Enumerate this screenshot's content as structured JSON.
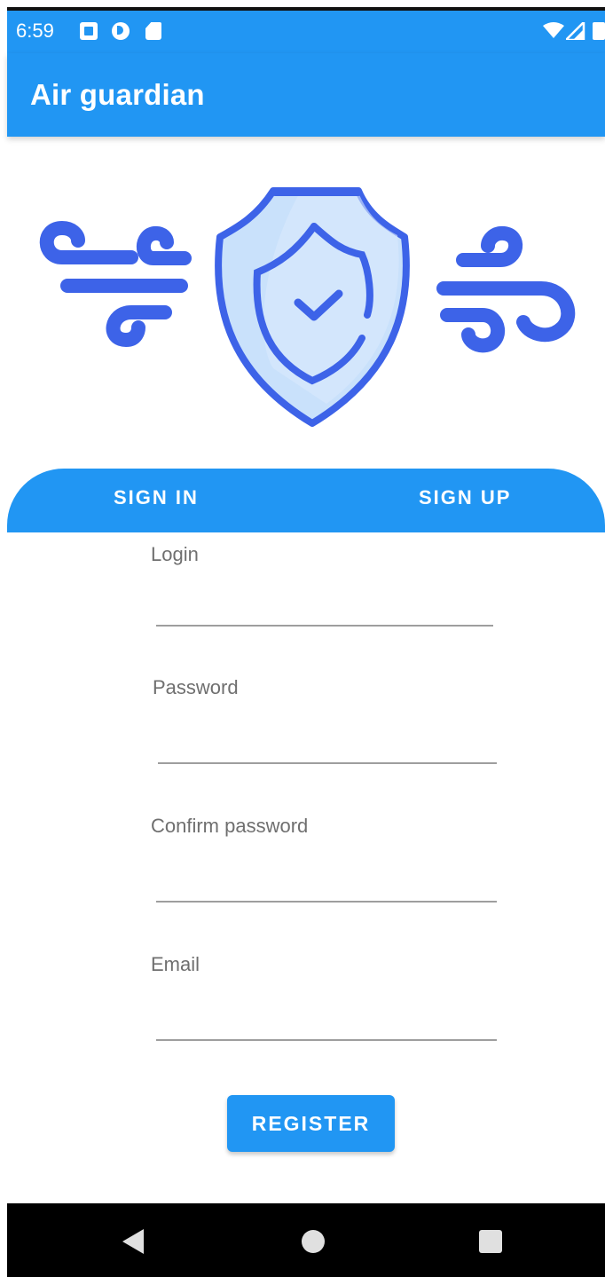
{
  "status_bar": {
    "time": "6:59",
    "icons": [
      "notification-a-icon",
      "notification-p-icon",
      "sd-card-icon",
      "wifi-icon",
      "signal-icon",
      "battery-icon"
    ]
  },
  "app_bar": {
    "title": "Air guardian"
  },
  "hero": {
    "icons": [
      "wind-left-icon",
      "shield-check-icon",
      "wind-right-icon"
    ]
  },
  "tabs": [
    {
      "label": "SIGN IN"
    },
    {
      "label": "SIGN UP"
    }
  ],
  "form": {
    "login": {
      "label": "Login",
      "value": ""
    },
    "password": {
      "label": "Password",
      "value": ""
    },
    "confirm_password": {
      "label": "Confirm password",
      "value": ""
    },
    "email": {
      "label": "Email",
      "value": ""
    }
  },
  "register_button": {
    "label": "REGISTER"
  },
  "nav_bar": {
    "icons": [
      "back-icon",
      "home-icon",
      "recents-icon"
    ]
  },
  "colors": {
    "primary": "#2196f3",
    "illustration_blue": "#3d63e8",
    "illustration_light": "#c9e1fb"
  }
}
